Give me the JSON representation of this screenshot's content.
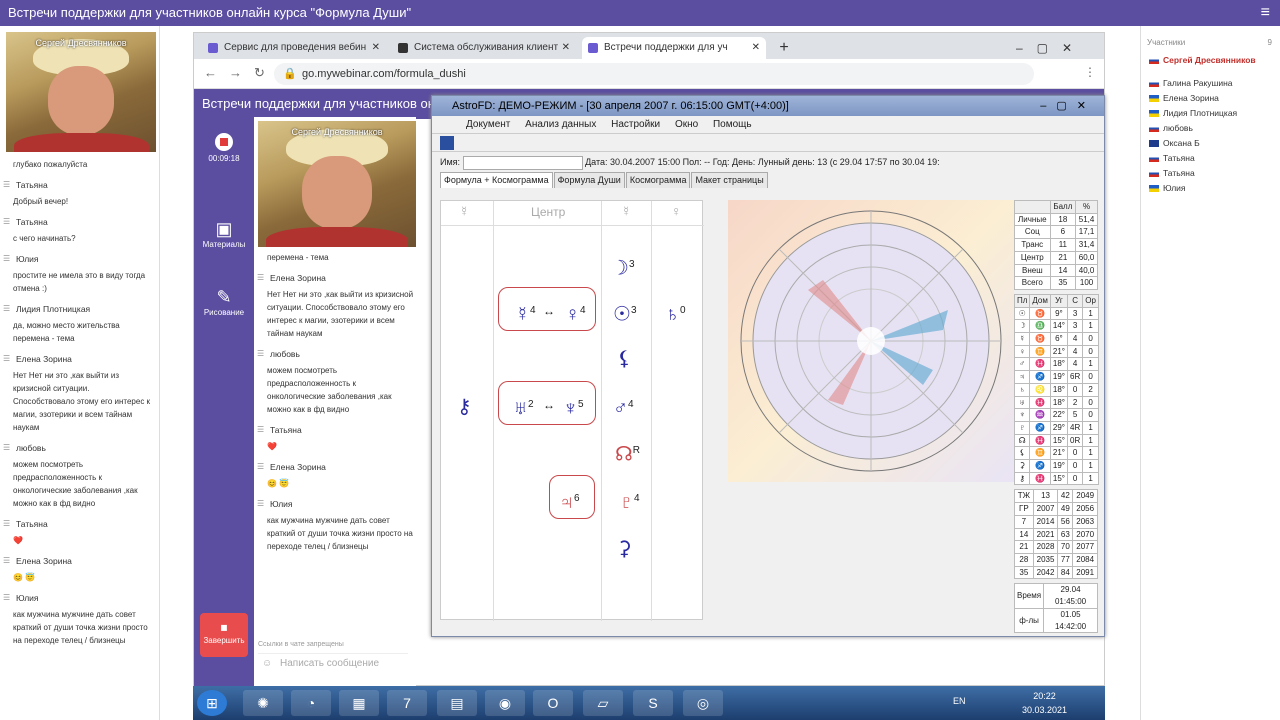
{
  "topbar": {
    "title": "Встречи поддержки для участников онлайн курса \"Формула Души\"",
    "menu": "≡"
  },
  "presenter": {
    "name": "Сергей Дресвянников"
  },
  "left_chat": [
    {
      "who": "",
      "text": "глубако пожалуйста"
    },
    {
      "who": "Татьяна",
      "text": "Добрый вечер!"
    },
    {
      "who": "Татьяна",
      "text": "с чего начинать?"
    },
    {
      "who": "Юлия",
      "text": "простите не имела это в виду тогда отмена :)"
    },
    {
      "who": "Лидия Плотницкая",
      "text": "да, можно место жительства перемена - тема"
    },
    {
      "who": "Елена Зорина",
      "text": "Нет Нет ни это ,как выйти из кризисной ситуации. Способствовало этому его интерес к магии, эзотерики и всем тайнам наукам"
    },
    {
      "who": "любовь",
      "text": "можем посмотреть предрасположенность к онкологические заболевания ,как можно как в фд видно"
    },
    {
      "who": "Татьяна",
      "text": "❤️"
    },
    {
      "who": "Елена Зорина",
      "text": "😊 😇"
    },
    {
      "who": "Юлия",
      "text": "как мужчина мужчине дать совет краткий от души точка жизни просто на переходе телец / близнецы"
    }
  ],
  "participants": {
    "label": "Участники",
    "count": "9",
    "items": [
      {
        "name": "Сергей Дресвянников",
        "flag": "ru",
        "bold": true
      },
      {
        "name": "Галина Ракушина",
        "flag": "ru"
      },
      {
        "name": "Елена Зорина",
        "flag": "ua"
      },
      {
        "name": "Лидия Плотницкая",
        "flag": "ua"
      },
      {
        "name": "любовь",
        "flag": "ru"
      },
      {
        "name": "Оксана Б",
        "flag": "gb"
      },
      {
        "name": "Татьяна",
        "flag": "ru"
      },
      {
        "name": "Татьяна",
        "flag": "ru"
      },
      {
        "name": "Юлия",
        "flag": "ua"
      }
    ]
  },
  "browser": {
    "tabs": [
      "Сервис для проведения вебин",
      "Система обслуживания клиент",
      "Встречи поддержки для уч"
    ],
    "url": "go.mywebinar.com/formula_dushi",
    "header": "Встречи поддержки для участников онл",
    "timer": "00:09:18",
    "materials": "Материалы",
    "drawing": "Рисование",
    "stop": "Завершить",
    "chat_input": "Написать сообщение",
    "chat_note": "Ссылки в чате запрещены"
  },
  "center_chat": [
    {
      "who": "",
      "text": "перемена - тема"
    },
    {
      "who": "Елена Зорина",
      "text": "Нет Нет ни это ,как выйти из кризисной ситуации. Способствовало этому его интерес к магии, эзотерики и всем тайнам наукам"
    },
    {
      "who": "любовь",
      "text": "можем посмотреть предрасположенность к онкологические заболевания ,как можно как в фд видно"
    },
    {
      "who": "Татьяна",
      "text": "❤️"
    },
    {
      "who": "Елена Зорина",
      "text": "😊 😇"
    },
    {
      "who": "Юлия",
      "text": "как мужчина мужчине дать совет краткий от души точка жизни просто на переходе телец / близнецы"
    }
  ],
  "astro": {
    "title": "AstroFD: ДЕМО-РЕЖИМ - [30 апреля 2007 г. 06:15:00 GMT(+4:00)]",
    "menu": [
      "Документ",
      "Анализ данных",
      "Настройки",
      "Окно",
      "Помощь"
    ],
    "name_label": "Имя:",
    "date_label": "Дата:",
    "date": "30.04.2007",
    "time": "15:00",
    "pol_label": "Пол:",
    "pol": "--",
    "year_label": "Год:",
    "day_label": "День:",
    "lunar": "Лунный день: 13 (с 29.04 17:57 по 30.04 19:",
    "tabs": [
      "Формула + Космограмма",
      "Формула Души",
      "Космограмма",
      "Макет страницы"
    ],
    "center_label": "Центр",
    "scores_head": [
      "Балл",
      "%"
    ],
    "scores": [
      [
        "Личные",
        "18",
        "51,4"
      ],
      [
        "Соц",
        "6",
        "17,1"
      ],
      [
        "Транс",
        "11",
        "31,4"
      ],
      [
        "Центр",
        "21",
        "60,0"
      ],
      [
        "Внеш",
        "14",
        "40,0"
      ],
      [
        "Всего",
        "35",
        "100"
      ]
    ],
    "planets_head": [
      "Пл",
      "Дом",
      "Уг",
      "С",
      "Ор"
    ],
    "planets": [
      [
        "☉",
        "♉",
        "9°",
        "3",
        "1"
      ],
      [
        "☽",
        "♎",
        "14°",
        "3",
        "1"
      ],
      [
        "☿",
        "♉",
        "6°",
        "4",
        "0"
      ],
      [
        "♀",
        "♊",
        "21°",
        "4",
        "0"
      ],
      [
        "♂",
        "♓",
        "18°",
        "4",
        "1"
      ],
      [
        "♃",
        "♐",
        "19°",
        "6R",
        "0"
      ],
      [
        "♄",
        "♌",
        "18°",
        "0",
        "2"
      ],
      [
        "♅",
        "♓",
        "18°",
        "2",
        "0"
      ],
      [
        "♆",
        "♒",
        "22°",
        "5",
        "0"
      ],
      [
        "♇",
        "♐",
        "29°",
        "4R",
        "1"
      ],
      [
        "☊",
        "♓",
        "15°",
        "0R",
        "1"
      ],
      [
        "⚸",
        "♊",
        "21°",
        "0",
        "1"
      ],
      [
        "⚳",
        "♐",
        "19°",
        "0",
        "1"
      ],
      [
        "⚷",
        "♓",
        "15°",
        "0",
        "1"
      ]
    ],
    "ages": [
      [
        "ТЖ",
        "13",
        "42",
        "2049"
      ],
      [
        "ГР",
        "2007",
        "49",
        "2056"
      ],
      [
        "7",
        "2014",
        "56",
        "2063"
      ],
      [
        "14",
        "2021",
        "63",
        "2070"
      ],
      [
        "21",
        "2028",
        "70",
        "2077"
      ],
      [
        "28",
        "2035",
        "77",
        "2084"
      ],
      [
        "35",
        "2042",
        "84",
        "2091"
      ]
    ],
    "time_rows": [
      [
        "Время",
        "29.04 01:45:00"
      ],
      [
        "ф-лы",
        "01.05 14:42:00"
      ]
    ]
  },
  "taskbar": {
    "lang": "EN",
    "time": "20:22",
    "date": "30.03.2021"
  }
}
